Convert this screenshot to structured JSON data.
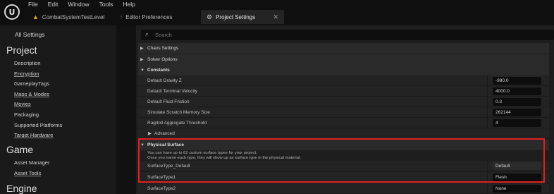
{
  "menu": [
    "File",
    "Edit",
    "Window",
    "Tools",
    "Help"
  ],
  "tabs": [
    {
      "label": "CombatSystemTestLevel",
      "icon": "level-icon"
    },
    {
      "label": "Editor Preferences",
      "icon": "sliders-icon"
    },
    {
      "label": "Project Settings",
      "icon": "settings-icon",
      "active": true
    }
  ],
  "search": {
    "placeholder": "Search"
  },
  "nav": {
    "all_settings": "All Settings",
    "project_heading": "Project",
    "project_items": [
      "Description",
      "Encryption",
      "GameplayTags",
      "Maps & Modes",
      "Movies",
      "Packaging",
      "Supported Platforms",
      "Target Hardware"
    ],
    "game_heading": "Game",
    "game_items": [
      "Asset Manager",
      "Asset Tools"
    ],
    "engine_heading": "Engine"
  },
  "sections": {
    "chaos": "Chaos Settings",
    "solver": "Solver Options",
    "constants": "Constants",
    "advanced": "Advanced",
    "physical_surface": "Physical Surface"
  },
  "constants": [
    {
      "label": "Default Gravity Z",
      "value": "-980.0"
    },
    {
      "label": "Default Terminal Velocity",
      "value": "4000.0"
    },
    {
      "label": "Default Fluid Friction",
      "value": "0.3"
    },
    {
      "label": "Simulate Scratch Memory Size",
      "value": "262144"
    },
    {
      "label": "Ragdoll Aggregate Threshold",
      "value": "4"
    }
  ],
  "physical_surface": {
    "desc_line1": "You can have up to 62 custom surface types for your project.",
    "desc_line2": "Once you name each type, they will show up as surface type in the physical material.",
    "rows": [
      {
        "label": "SurfaceType_Default",
        "value": "Default"
      },
      {
        "label": "SurfaceType1",
        "value": "Flesh"
      },
      {
        "label": "SurfaceType2",
        "value": "None"
      }
    ]
  },
  "highlight_color": "#e02020"
}
